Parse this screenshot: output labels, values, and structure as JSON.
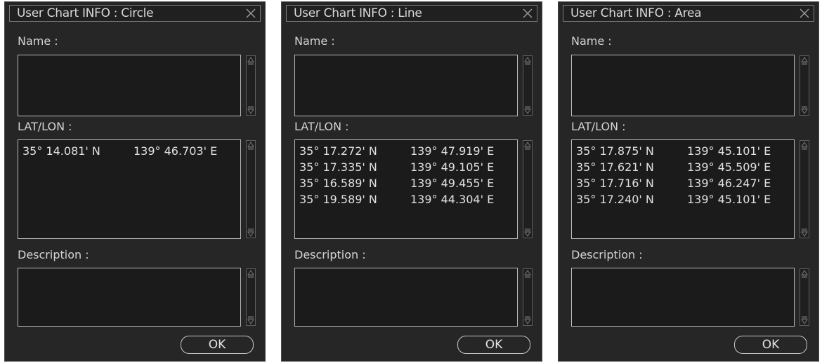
{
  "dialogs": [
    {
      "title": "User Chart INFO : Circle",
      "name_label": "Name :",
      "name_value": "",
      "latlon_label": "LAT/LON :",
      "coordinates": [
        {
          "lat": "35° 14.081' N",
          "lon": "139° 46.703' E"
        }
      ],
      "description_label": "Description :",
      "description_value": "",
      "ok_label": "OK"
    },
    {
      "title": "User Chart INFO : Line",
      "name_label": "Name :",
      "name_value": "",
      "latlon_label": "LAT/LON :",
      "coordinates": [
        {
          "lat": "35° 17.272' N",
          "lon": "139° 47.919' E"
        },
        {
          "lat": "35° 17.335' N",
          "lon": "139° 49.105' E"
        },
        {
          "lat": "35° 16.589' N",
          "lon": "139° 49.455' E"
        },
        {
          "lat": "35° 19.589' N",
          "lon": "139° 44.304' E"
        }
      ],
      "description_label": "Description :",
      "description_value": "",
      "ok_label": "OK"
    },
    {
      "title": "User Chart INFO : Area",
      "name_label": "Name :",
      "name_value": "",
      "latlon_label": "LAT/LON :",
      "coordinates": [
        {
          "lat": "35° 17.875' N",
          "lon": "139° 45.101' E"
        },
        {
          "lat": "35° 17.621' N",
          "lon": "139° 45.509' E"
        },
        {
          "lat": "35° 17.716' N",
          "lon": "139° 46.247' E"
        },
        {
          "lat": "35° 17.240' N",
          "lon": "139° 45.101' E"
        }
      ],
      "description_label": "Description :",
      "description_value": "",
      "ok_label": "OK"
    }
  ],
  "icons": {
    "close": "close-icon",
    "scroll_up": "scroll-up-icon",
    "scroll_down": "scroll-down-icon"
  },
  "colors": {
    "dialog_bg": "#262626",
    "field_border": "#bdbdbd",
    "text": "#d4d4d4"
  }
}
